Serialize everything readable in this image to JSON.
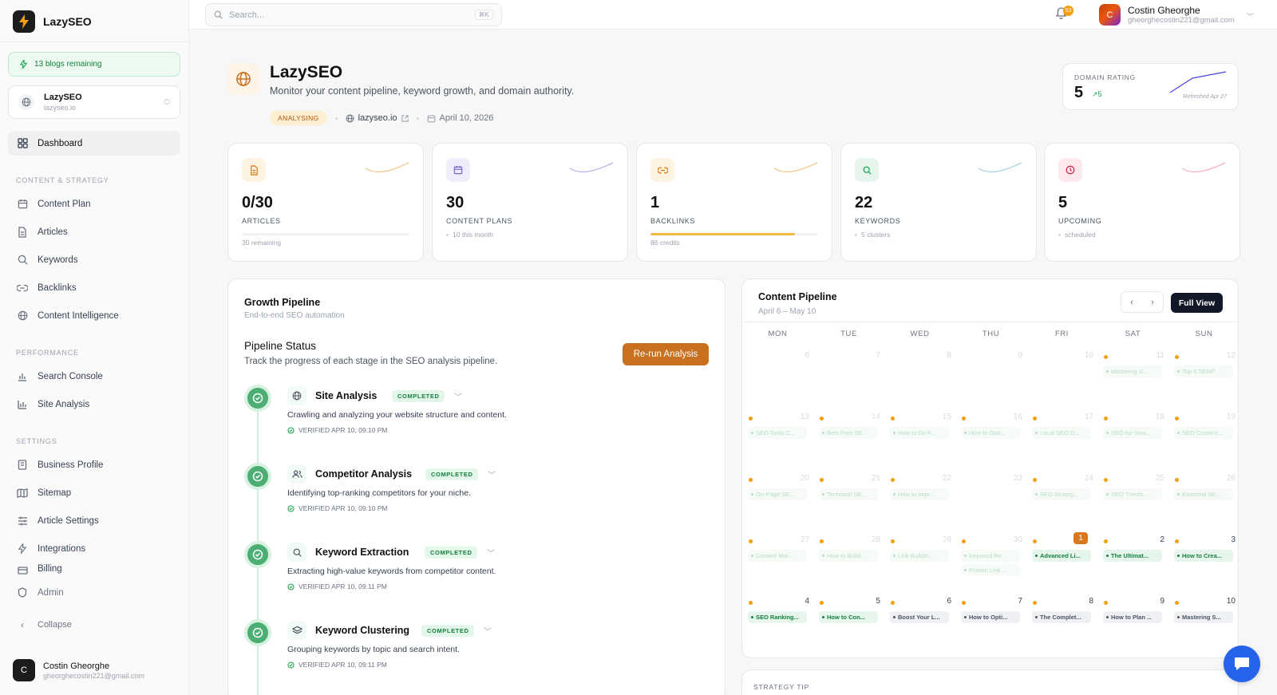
{
  "brand": {
    "name": "LazySEO"
  },
  "sidebar": {
    "blogs_remaining": "13 blogs remaining",
    "site": {
      "name": "LazySEO",
      "url": "lazyseo.io"
    },
    "dashboard": "Dashboard",
    "section_content": "CONTENT & STRATEGY",
    "content_items": [
      "Content Plan",
      "Articles",
      "Keywords",
      "Backlinks",
      "Content Intelligence"
    ],
    "section_performance": "PERFORMANCE",
    "performance_items": [
      "Search Console",
      "Site Analysis"
    ],
    "section_settings": "SETTINGS",
    "settings_items": [
      "Business Profile",
      "Sitemap",
      "Article Settings",
      "Integrations",
      "Billing"
    ],
    "admin": "Admin",
    "collapse": "Collapse",
    "user": {
      "initial": "C",
      "name": "Costin Gheorghe",
      "email": "gheorghecostin221@gmail.com"
    }
  },
  "topbar": {
    "search_placeholder": "Search...",
    "shortcut": "⌘K",
    "notification_count": "53",
    "user": {
      "initial": "C",
      "name": "Costin Gheorghe",
      "email": "gheorghecostin221@gmail.com"
    }
  },
  "hero": {
    "title": "LazySEO",
    "subtitle": "Monitor your content pipeline, keyword growth, and domain authority.",
    "status": "ANALYSING",
    "domain": "lazyseo.io",
    "date": "April 10, 2026"
  },
  "domain_rating": {
    "label": "DOMAIN RATING",
    "value": "5",
    "delta": "5",
    "refreshed": "Refreshed Apr 27"
  },
  "stats": [
    {
      "value": "0/30",
      "label": "ARTICLES",
      "foot": "30 remaining",
      "progress": 0
    },
    {
      "value": "30",
      "label": "CONTENT PLANS",
      "foot": "10 this month"
    },
    {
      "value": "1",
      "label": "BACKLINKS",
      "foot": "86 credits",
      "progress": 0.86
    },
    {
      "value": "22",
      "label": "KEYWORDS",
      "foot": "5 clusters"
    },
    {
      "value": "5",
      "label": "UPCOMING",
      "foot": "scheduled"
    }
  ],
  "growth": {
    "title": "Growth Pipeline",
    "subtitle": "End-to-end SEO automation",
    "status_title": "Pipeline Status",
    "status_sub": "Track the progress of each stage in the SEO analysis pipeline.",
    "rerun": "Re-run Analysis",
    "stages": [
      {
        "name": "Site Analysis",
        "badge": "COMPLETED",
        "desc": "Crawling and analyzing your website structure and content.",
        "verified": "VERIFIED APR 10, 09:10 PM"
      },
      {
        "name": "Competitor Analysis",
        "badge": "COMPLETED",
        "desc": "Identifying top-ranking competitors for your niche.",
        "verified": "VERIFIED APR 10, 09:10 PM"
      },
      {
        "name": "Keyword Extraction",
        "badge": "COMPLETED",
        "desc": "Extracting high-value keywords from competitor content.",
        "verified": "VERIFIED APR 10, 09:11 PM"
      },
      {
        "name": "Keyword Clustering",
        "badge": "COMPLETED",
        "desc": "Grouping keywords by topic and search intent.",
        "verified": "VERIFIED APR 10, 09:11 PM"
      }
    ]
  },
  "calendar": {
    "title": "Content Pipeline",
    "range": "April 6 – May 10",
    "full_view": "Full View",
    "days": [
      "MON",
      "TUE",
      "WED",
      "THU",
      "FRI",
      "SAT",
      "SUN"
    ],
    "weeks": [
      [
        {
          "n": "6"
        },
        {
          "n": "7"
        },
        {
          "n": "8"
        },
        {
          "n": "9"
        },
        {
          "n": "10"
        },
        {
          "n": "11",
          "e": [
            "Mastering S..."
          ]
        },
        {
          "n": "12",
          "e": [
            "Top 5 SERP ..."
          ]
        }
      ],
      [
        {
          "n": "13",
          "e": [
            "SEO Tools C..."
          ]
        },
        {
          "n": "14",
          "e": [
            "Best Free SE..."
          ]
        },
        {
          "n": "15",
          "e": [
            "How to Do K..."
          ]
        },
        {
          "n": "16",
          "e": [
            "How to Opti..."
          ]
        },
        {
          "n": "17",
          "e": [
            "Local SEO O..."
          ]
        },
        {
          "n": "18",
          "e": [
            "SEO for Sma..."
          ]
        },
        {
          "n": "19",
          "e": [
            "SEO Content..."
          ]
        }
      ],
      [
        {
          "n": "20",
          "e": [
            "On-Page SE..."
          ]
        },
        {
          "n": "21",
          "e": [
            "Technical SE..."
          ]
        },
        {
          "n": "22",
          "e": [
            "How to Impr..."
          ]
        },
        {
          "n": "23"
        },
        {
          "n": "24",
          "e": [
            "SEO Strateg..."
          ]
        },
        {
          "n": "25",
          "e": [
            "SEO Trends ..."
          ]
        },
        {
          "n": "26",
          "e": [
            "Essential SE..."
          ]
        }
      ],
      [
        {
          "n": "27",
          "e": [
            "Content Mar..."
          ]
        },
        {
          "n": "28",
          "e": [
            "How to Build..."
          ]
        },
        {
          "n": "29",
          "e": [
            "Link Buildin..."
          ]
        },
        {
          "n": "30",
          "e": [
            "Keyword Re...",
            "Proven Link ..."
          ]
        },
        {
          "n": "1",
          "e": [
            "Advanced Li..."
          ],
          "s": "green",
          "today": true
        },
        {
          "n": "2",
          "e": [
            "The Ultimat..."
          ],
          "s": "green"
        },
        {
          "n": "3",
          "e": [
            "How to Crea..."
          ],
          "s": "green"
        }
      ],
      [
        {
          "n": "4",
          "e": [
            "SEO Ranking..."
          ],
          "s": "green"
        },
        {
          "n": "5",
          "e": [
            "How to Con..."
          ],
          "s": "green"
        },
        {
          "n": "6",
          "e": [
            "Boost Your L..."
          ],
          "s": "gray"
        },
        {
          "n": "7",
          "e": [
            "How to Opti..."
          ],
          "s": "gray"
        },
        {
          "n": "8",
          "e": [
            "The Complet..."
          ],
          "s": "gray"
        },
        {
          "n": "9",
          "e": [
            "How to Plan ..."
          ],
          "s": "gray"
        },
        {
          "n": "10",
          "e": [
            "Mastering S..."
          ],
          "s": "gray"
        }
      ]
    ]
  },
  "tip": {
    "label": "STRATEGY TIP"
  },
  "colors": {
    "accent": "#c9701e",
    "success": "#4cae73",
    "badge_bg": "#fdefd2"
  }
}
